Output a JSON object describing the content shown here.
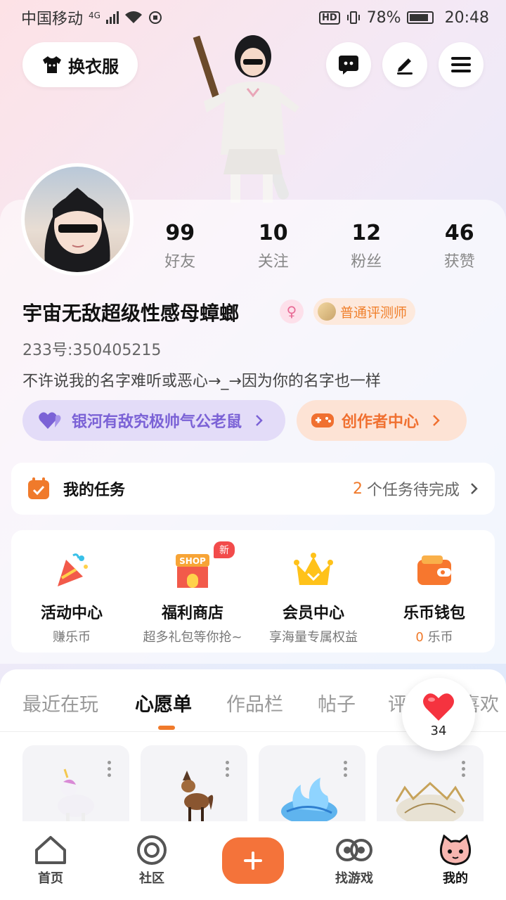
{
  "status_bar": {
    "carrier": "中国移动",
    "network": "4G",
    "battery": "78%",
    "time": "20:48"
  },
  "header": {
    "outfit_label": "换衣服",
    "icons": [
      "chat-icon",
      "edit-icon",
      "menu-icon"
    ]
  },
  "profile": {
    "stats": [
      {
        "value": "99",
        "label": "好友"
      },
      {
        "value": "10",
        "label": "关注"
      },
      {
        "value": "12",
        "label": "粉丝"
      },
      {
        "value": "46",
        "label": "获赞"
      }
    ],
    "nickname": "宇宙无敌超级性感母蟑螂",
    "gender_symbol": "♀",
    "title_badge": "普通评测师",
    "uid": "233号:350405215",
    "bio": "不许说我的名字难听或恶心→_→因为你的名字也一样",
    "galaxy_link": "银河有敌究极帅气公老鼠",
    "creator_center": "创作者中心"
  },
  "tasks": {
    "title": "我的任务",
    "count": "2",
    "suffix": "个任务待完成"
  },
  "services": [
    {
      "title": "活动中心",
      "sub": "赚乐币"
    },
    {
      "title": "福利商店",
      "sub": "超多礼包等你抢~",
      "badge": "新",
      "icon_text": "SHOP"
    },
    {
      "title": "会员中心",
      "sub": "享海量专属权益"
    },
    {
      "title": "乐币钱包",
      "sub_value": "0",
      "sub": "乐币"
    }
  ],
  "tabs": [
    "最近在玩",
    "心愿单",
    "作品栏",
    "帖子",
    "评",
    "喜欢"
  ],
  "active_tab": "心愿单",
  "like_count": "34",
  "bottom_nav": [
    {
      "label": "首页"
    },
    {
      "label": "社区"
    },
    {
      "label": ""
    },
    {
      "label": "找游戏"
    },
    {
      "label": "我的"
    }
  ],
  "colors": {
    "accent": "#f07a2b",
    "purple": "#7b62d6",
    "plus": "#f4733a"
  }
}
